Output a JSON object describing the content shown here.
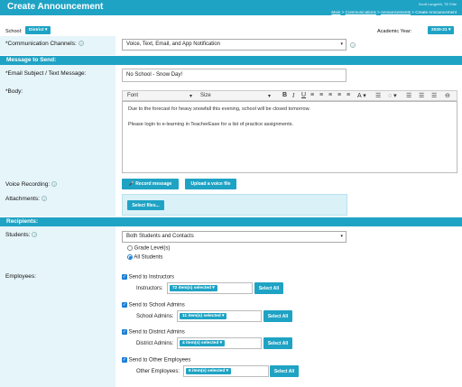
{
  "header": {
    "title": "Create Announcement",
    "user": "Scott Langreth, TE Elite"
  },
  "breadcrumb": {
    "items": [
      "Main",
      "Communications",
      "Announcements"
    ],
    "current": "Create Announcement",
    "sep": " > "
  },
  "school": {
    "label": "School:",
    "value": "District"
  },
  "year": {
    "label": "Academic Year:",
    "value": "2020-21"
  },
  "channels": {
    "label": "*Communication Channels:",
    "value": "Voice, Text, Email, and App Notification"
  },
  "message_section": "Message to Send:",
  "subject": {
    "label": "*Email Subject / Text Message:",
    "value": "No School - Snow Day!"
  },
  "body": {
    "label": "*Body:",
    "font": "Font",
    "size": "Size",
    "lines": [
      "Due to the forecast for heavy snowfall this evening, school will be closed tomorrow.",
      "Please login to e-learning in TeacherEase for a list of practice assignments."
    ]
  },
  "toolbar": {
    "bold": "B",
    "italic": "I",
    "underline": "U",
    "text_color": "A"
  },
  "voice": {
    "label": "Voice Recording:",
    "record": "Record message",
    "upload": "Upload a voice file"
  },
  "attachments": {
    "label": "Attachments:",
    "select": "Select files..."
  },
  "recipients_section": "Recipients:",
  "students": {
    "label": "Students:",
    "value": "Both Students and Contacts",
    "options": [
      "Grade Level(s)",
      "All Students"
    ]
  },
  "employees": {
    "label": "Employees:",
    "groups": [
      {
        "check": "Send to Instructors",
        "sublabel": "Instructors:",
        "selected": "72 item(s) selected",
        "select_all": "Select All"
      },
      {
        "check": "Send to School Admins",
        "sublabel": "School Admins:",
        "selected": "11 item(s) selected",
        "select_all": "Select All"
      },
      {
        "check": "Send to District Admins",
        "sublabel": "District Admins:",
        "selected": "4 item(s) selected",
        "select_all": "Select All"
      },
      {
        "check": "Send to Other Employees",
        "sublabel": "Other Employees:",
        "selected": "6 item(s) selected",
        "select_all": "Select All"
      }
    ]
  },
  "colors": {
    "accent": "#1fa3c4",
    "left_panel": "#e6f5fa",
    "checkbox": "#1f7fd6"
  }
}
